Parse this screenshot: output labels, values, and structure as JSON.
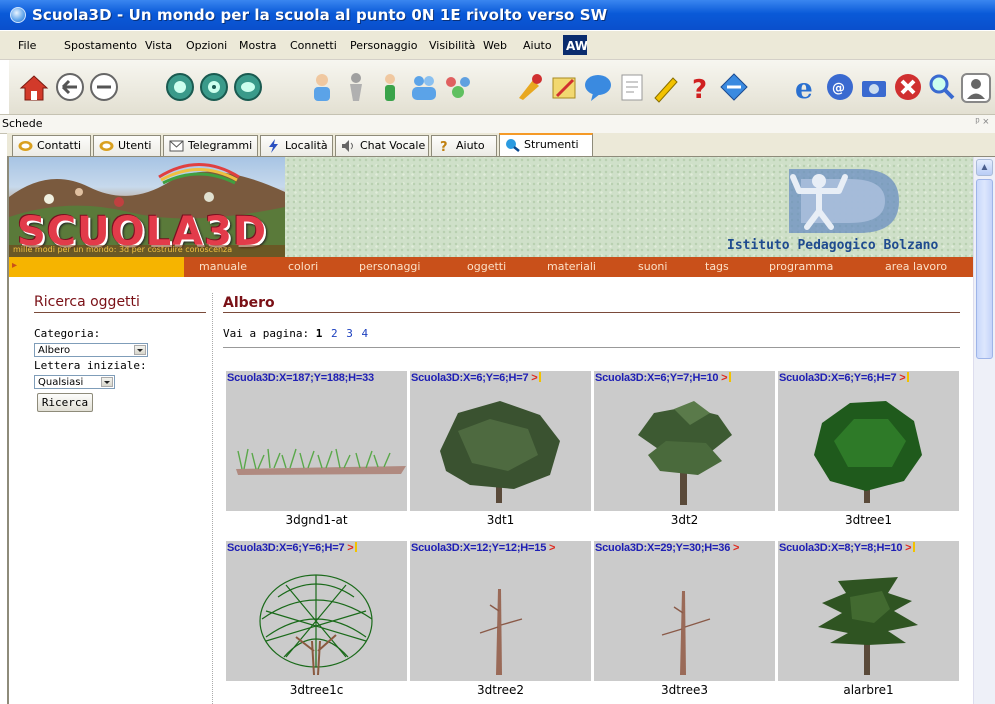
{
  "window": {
    "title": "Scuola3D  - Un mondo per la scuola al punto 0N 1E  rivolto verso SW"
  },
  "menu": [
    "File",
    "Spostamento",
    "Vista",
    "Opzioni",
    "Mostra",
    "Connetti",
    "Personaggio",
    "Visibilità",
    "Web",
    "Aiuto"
  ],
  "panel": {
    "label": "Schede",
    "controls": "ᵖ ×"
  },
  "tabs": [
    "Contatti",
    "Utenti",
    "Telegrammi",
    "Località",
    "Chat Vocale",
    "Aiuto",
    "Strumenti"
  ],
  "site": {
    "logo_text": "SCUOLA3D",
    "logo_tagline": "mille modi per un mondo: 3d per costruire conoscenza",
    "institute": "Istituto Pedagogico Bolzano",
    "nav": [
      "manuale",
      "colori",
      "personaggi",
      "oggetti",
      "materiali",
      "suoni",
      "tags",
      "programma",
      "area lavoro"
    ]
  },
  "search": {
    "title": "Ricerca oggetti",
    "category_label": "Categoria:",
    "category_value": "Albero",
    "letter_label": "Lettera iniziale:",
    "letter_value": "Qualsiasi",
    "button": "Ricerca"
  },
  "results": {
    "title": "Albero",
    "pager_label": "Vai a pagina:",
    "current_page": "1",
    "pages": [
      "2",
      "3",
      "4"
    ],
    "items": [
      {
        "coord": "Scuola3D:X=187;Y=188;H=33",
        "name": "3dgnd1-at"
      },
      {
        "coord": "Scuola3D:X=6;Y=6;H=7",
        "name": "3dt1"
      },
      {
        "coord": "Scuola3D:X=6;Y=7;H=10",
        "name": "3dt2"
      },
      {
        "coord": "Scuola3D:X=6;Y=6;H=7",
        "name": "3dtree1"
      },
      {
        "coord": "Scuola3D:X=6;Y=6;H=7",
        "name": "3dtree1c"
      },
      {
        "coord": "Scuola3D:X=12;Y=12;H=15",
        "name": "3dtree2"
      },
      {
        "coord": "Scuola3D:X=29;Y=30;H=36",
        "name": "3dtree3"
      },
      {
        "coord": "Scuola3D:X=8;Y=8;H=10",
        "name": "alarbre1"
      }
    ]
  },
  "colors": {
    "titlebar": "#0a5ad8",
    "nav": "#c9501a",
    "nav_highlight": "#f6b400",
    "heading": "#7a1016",
    "coord_text": "#1e1eb4",
    "active_tab": "#f59a27"
  }
}
